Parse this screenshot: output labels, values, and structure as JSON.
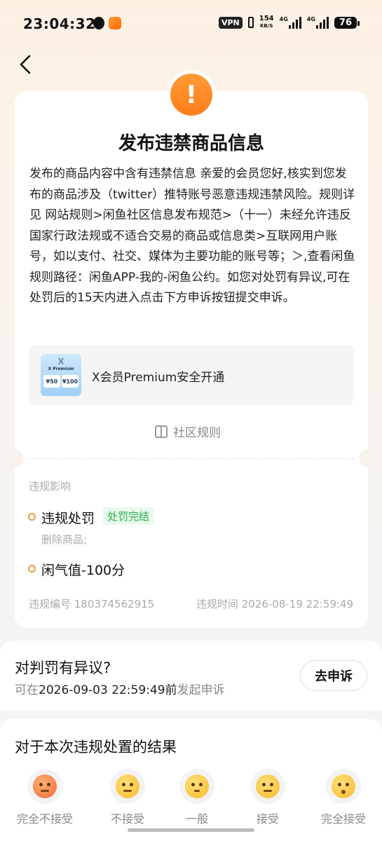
{
  "status_bar": {
    "time": "23:04:32",
    "vpn": "VPN",
    "net_speed_value": "154",
    "net_speed_unit": "KB/S",
    "signal_1": "4G",
    "signal_2": "4G",
    "battery": "76"
  },
  "nav": {
    "back_icon": "chevron-left-icon"
  },
  "violation": {
    "icon": "exclamation-icon",
    "title": "发布违禁商品信息",
    "description": "发布的商品内容中含有违禁信息 亲爱的会员您好,核实到您发布的商品涉及（twitter）推特账号恶意违规违禁风险。规则详见 网站规则>闲鱼社区信息发布规范>（十一）未经允许违反国家行政法规或不适合交易的商品或信息类>互联网用户账号，如以支付、社交、媒体为主要功能的账号等；＞,查看闲鱼规则路径：闲鱼APP-我的-闲鱼公约。如您对处罚有异议,可在处罚后的15天内进入点击下方申诉按钮提交申诉。",
    "product": {
      "thumb_logo": "X",
      "thumb_title": "X Premium",
      "thumb_price_1": "¥50",
      "thumb_price_2": "¥100",
      "name": "X会员Premium安全开通"
    },
    "rules_link": "社区规则",
    "impact_label": "违规影响",
    "penalty_title": "违规处罚",
    "penalty_badge": "处罚完结",
    "penalty_detail": "删除商品;",
    "credit_penalty": "闲气值-100分",
    "violation_id": "违规编号 180374562915",
    "violation_time": "违规时间 2026-08-19 22:59:49"
  },
  "appeal": {
    "title": "对判罚有异议?",
    "prefix": "可在",
    "deadline": "2026-09-03 22:59:49前",
    "suffix": "发起申诉",
    "button": "去申诉"
  },
  "feedback": {
    "title": "对于本次违规处置的结果",
    "options": [
      {
        "label": "完全不接受",
        "icon": "angry-face-icon"
      },
      {
        "label": "不接受",
        "icon": "unamused-face-icon"
      },
      {
        "label": "一般",
        "icon": "neutral-face-icon"
      },
      {
        "label": "接受",
        "icon": "thinking-face-icon"
      },
      {
        "label": "完全接受",
        "icon": "kissing-face-icon"
      }
    ]
  },
  "colors": {
    "accent_orange": "#ff8a24",
    "success_green": "#27b050",
    "dot_orange": "#e8a040"
  }
}
